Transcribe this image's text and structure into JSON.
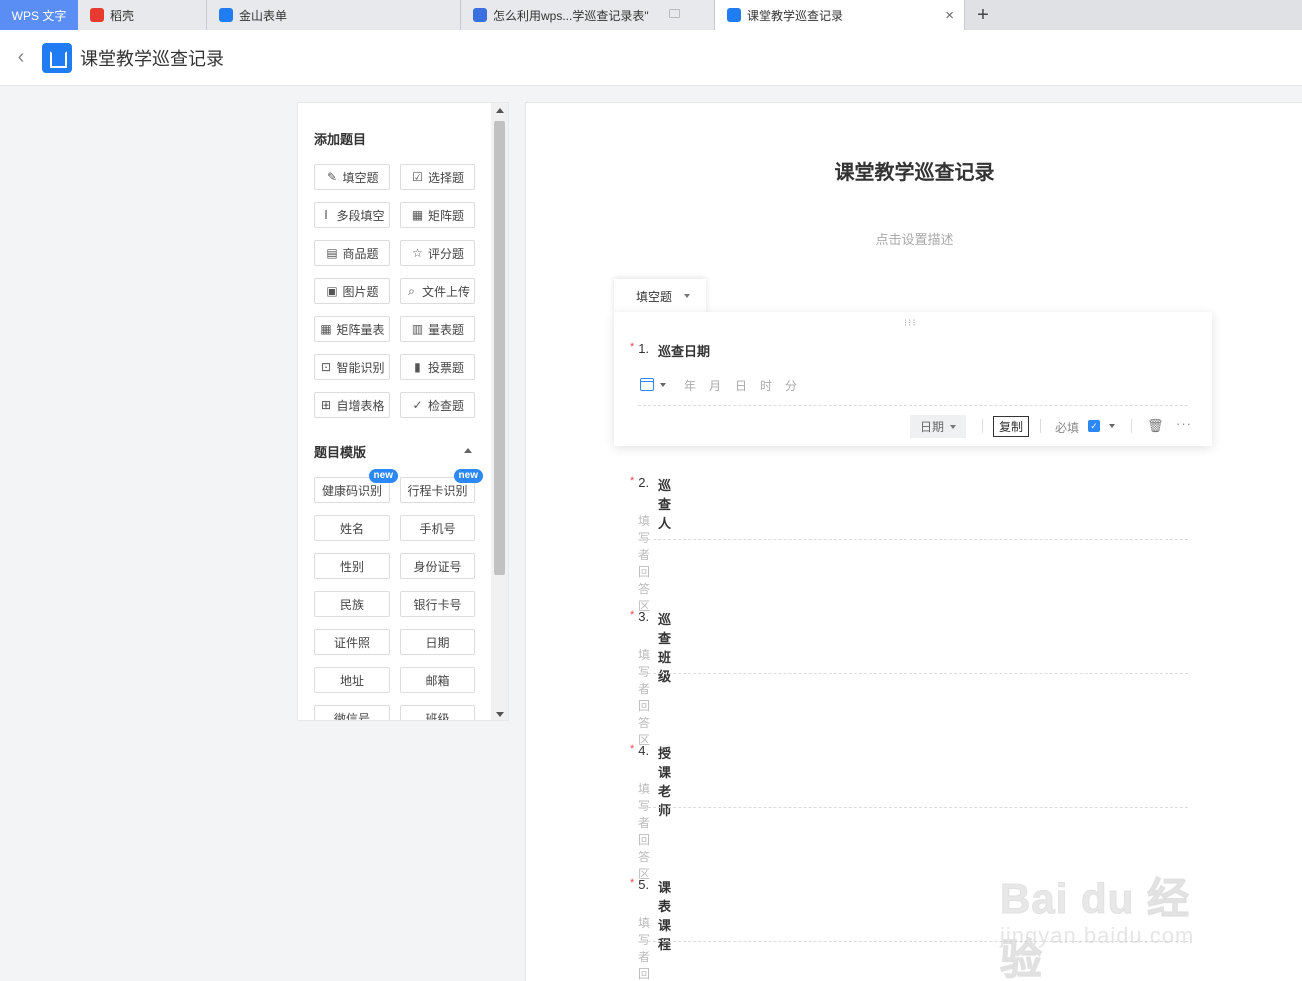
{
  "tabs": {
    "app_label": "WPS 文字",
    "items": [
      {
        "label": "稻壳",
        "color": "#e63b2e"
      },
      {
        "label": "金山表单",
        "color": "#1f7cf3"
      },
      {
        "label": "怎么利用wps...学巡查记录表\"",
        "color": "#3b6fe0"
      },
      {
        "label": "课堂教学巡查记录",
        "color": "#1f7cf3"
      }
    ],
    "close_icon": "×",
    "add_icon": "+"
  },
  "header": {
    "back_icon": "‹",
    "title": "课堂教学巡查记录"
  },
  "panel": {
    "add_section_title": "添加题目",
    "question_types": [
      {
        "icon": "✎",
        "label": "填空题"
      },
      {
        "icon": "☑",
        "label": "选择题"
      },
      {
        "icon": "Ⅰ",
        "label": "多段填空"
      },
      {
        "icon": "▦",
        "label": "矩阵题"
      },
      {
        "icon": "▤",
        "label": "商品题"
      },
      {
        "icon": "☆",
        "label": "评分题"
      },
      {
        "icon": "▣",
        "label": "图片题"
      },
      {
        "icon": "⌕",
        "label": "文件上传"
      },
      {
        "icon": "▦",
        "label": "矩阵量表"
      },
      {
        "icon": "▥",
        "label": "量表题"
      },
      {
        "icon": "⊡",
        "label": "智能识别"
      },
      {
        "icon": "▮",
        "label": "投票题"
      },
      {
        "icon": "⊞",
        "label": "自增表格"
      },
      {
        "icon": "✓",
        "label": "检查题"
      }
    ],
    "template_section_title": "题目模版",
    "new_badge": "new",
    "templates": [
      "健康码识别",
      "行程卡识别",
      "姓名",
      "手机号",
      "性别",
      "身份证号",
      "民族",
      "银行卡号",
      "证件照",
      "日期",
      "地址",
      "邮箱",
      "微信号",
      "班级"
    ]
  },
  "form": {
    "title": "课堂教学巡查记录",
    "description": "点击设置描述",
    "question_type_tab": "填空题",
    "drag_handle": "⁝⁝⁝",
    "questions": [
      {
        "num": "1.",
        "label": "巡查日期",
        "required": "*"
      },
      {
        "num": "2.",
        "label": "巡查人",
        "required": "*",
        "hint": "填写者回答区"
      },
      {
        "num": "3.",
        "label": "巡查班级",
        "required": "*",
        "hint": "填写者回答区"
      },
      {
        "num": "4.",
        "label": "授课老师",
        "required": "*",
        "hint": "填写者回答区"
      },
      {
        "num": "5.",
        "label": "课表课程",
        "required": "*",
        "hint": "填写者回答区"
      }
    ],
    "date_parts": [
      "年",
      "月",
      "日",
      "时",
      "分"
    ],
    "toolbar": {
      "date_type": "日期",
      "copy": "复制",
      "required": "必填",
      "check": "✓",
      "delete_icon": "🗑",
      "more": "···"
    }
  },
  "watermark": {
    "main": "Bai du 经验",
    "sub": "jingyan.baidu.com"
  }
}
